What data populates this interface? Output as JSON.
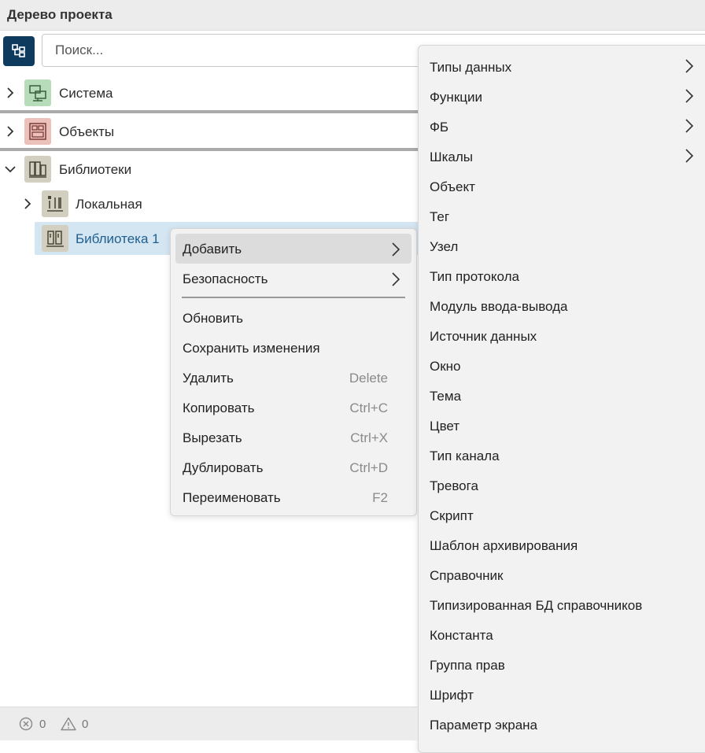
{
  "panel": {
    "title": "Дерево проекта"
  },
  "search": {
    "placeholder": "Поиск..."
  },
  "tree": {
    "system": "Система",
    "objects": "Объекты",
    "libraries": "Библиотеки",
    "local": "Локальная",
    "library1": "Библиотека 1"
  },
  "context_menu": {
    "items": [
      {
        "label": "Добавить",
        "shortcut": ""
      },
      {
        "label": "Безопасность",
        "shortcut": ""
      },
      {
        "label": "Обновить",
        "shortcut": ""
      },
      {
        "label": "Сохранить изменения",
        "shortcut": ""
      },
      {
        "label": "Удалить",
        "shortcut": "Delete"
      },
      {
        "label": "Копировать",
        "shortcut": "Ctrl+C"
      },
      {
        "label": "Вырезать",
        "shortcut": "Ctrl+X"
      },
      {
        "label": "Дублировать",
        "shortcut": "Ctrl+D"
      },
      {
        "label": "Переименовать",
        "shortcut": "F2"
      }
    ]
  },
  "submenu": {
    "items": [
      "Типы данных",
      "Функции",
      "ФБ",
      "Шкалы",
      "Объект",
      "Тег",
      "Узел",
      "Тип протокола",
      "Модуль ввода-вывода",
      "Источник данных",
      "Окно",
      "Тема",
      "Цвет",
      "Тип канала",
      "Тревога",
      "Скрипт",
      "Шаблон архивирования",
      "Справочник",
      "Типизированная БД справочников",
      "Константа",
      "Группа прав",
      "Шрифт",
      "Параметр экрана"
    ]
  },
  "status": {
    "errors": "0",
    "warnings": "0"
  },
  "colors": {
    "accent": "#0e3a5e",
    "selected_bg": "#d4e6f2",
    "selected_text": "#1f5f8f",
    "system_icon_bg": "#b7dcb9",
    "objects_icon_bg": "#edc1bb",
    "library_icon_bg": "#d2cfc0"
  }
}
